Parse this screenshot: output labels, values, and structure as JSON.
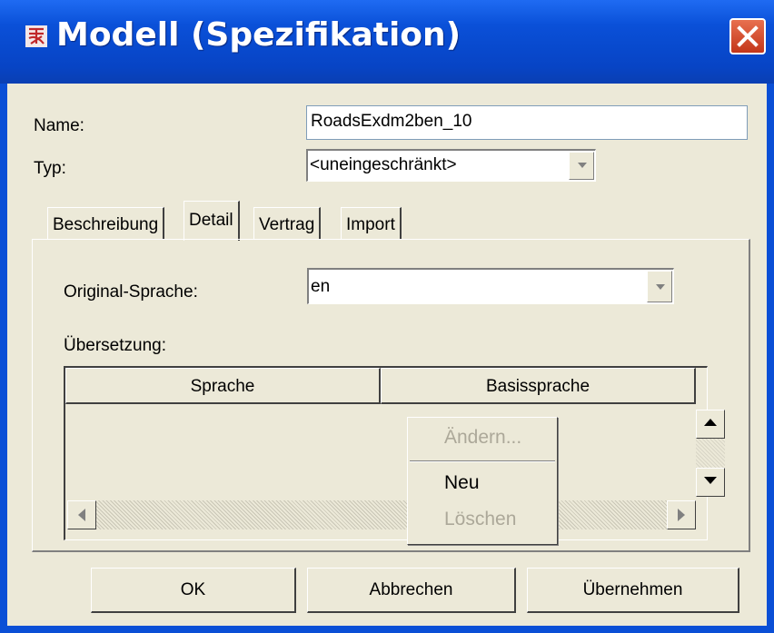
{
  "window": {
    "title": "Modell (Spezifikation)",
    "app_icon": "app-logo-icon",
    "close_icon": "close-icon"
  },
  "form": {
    "name_label": "Name:",
    "name_value": "RoadsExdm2ben_10",
    "typ_label": "Typ:",
    "typ_value": "<uneingeschränkt>"
  },
  "tabs": [
    {
      "label": "Beschreibung",
      "selected": false
    },
    {
      "label": "Detail",
      "selected": true
    },
    {
      "label": "Vertrag",
      "selected": false
    },
    {
      "label": "Import",
      "selected": false
    }
  ],
  "detail": {
    "original_label": "Original-Sprache:",
    "original_value": "en",
    "translation_label": "Übersetzung:",
    "columns": [
      "Sprache",
      "Basissprache"
    ]
  },
  "context_menu": {
    "items": [
      {
        "label": "Ändern...",
        "enabled": false
      },
      {
        "label": "Neu",
        "enabled": true
      },
      {
        "label": "Löschen",
        "enabled": false
      }
    ]
  },
  "buttons": {
    "ok": "OK",
    "cancel": "Abbrechen",
    "apply": "Übernehmen"
  },
  "colors": {
    "titlebar": "#0a50d8",
    "dialog_bg": "#ece9d8",
    "close_red": "#d9482a",
    "disabled_text": "#aca899"
  }
}
